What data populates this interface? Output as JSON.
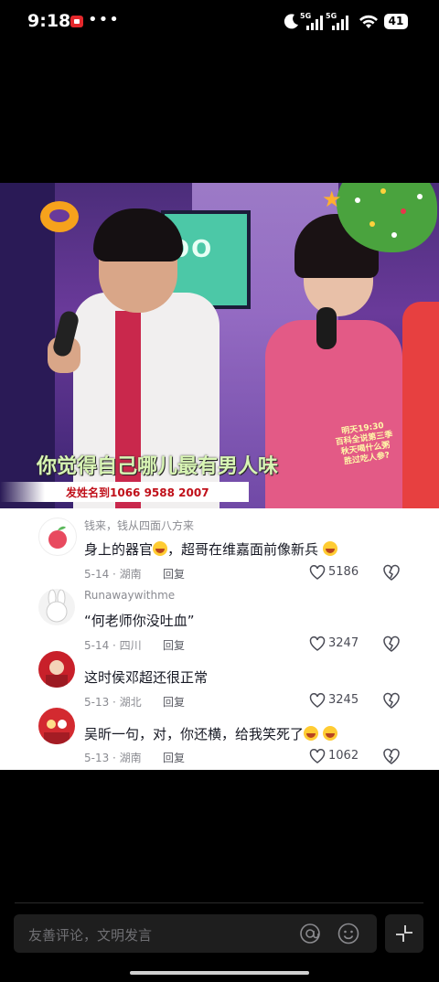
{
  "status_bar": {
    "time": "9:18",
    "dots": "•••",
    "signal1_label": "5G",
    "signal2_label": "5G",
    "battery": "41"
  },
  "video": {
    "screen_text": "OO",
    "subtitle": "你觉得自己哪儿最有男人味",
    "ticker": "发姓名到1066 9588 2007",
    "side_promo": [
      "明天19:30",
      "百科全说第三季",
      "秋天喝什么粥",
      "胜过吃人参?"
    ]
  },
  "comments": [
    {
      "username": "钱来，钱从四面八方来",
      "text": "身上的器官",
      "text_after": "，超哥在维嘉面前像新兵",
      "date_location": "5-14 · 湖南",
      "reply": "回复",
      "likes": "5186"
    },
    {
      "username": "Runawaywithme",
      "text": "“何老师你没吐血”",
      "date_location": "5-14 · 四川",
      "reply": "回复",
      "likes": "3247"
    },
    {
      "username": "",
      "text": "这时侯邓超还很正常",
      "date_location": "5-13 · 湖北",
      "reply": "回复",
      "likes": "3245"
    },
    {
      "username": "",
      "text": "吴昕一句，对，你还横，给我笑死了",
      "date_location": "5-13 · 湖南",
      "reply": "回复",
      "likes": "1062"
    }
  ],
  "input": {
    "placeholder": "友善评论，文明发言"
  },
  "icons": {
    "at": "at-icon",
    "emoji": "emoji-icon",
    "expand": "collapse-arrows-icon",
    "like": "heart-icon",
    "dislike": "broken-heart-icon"
  }
}
